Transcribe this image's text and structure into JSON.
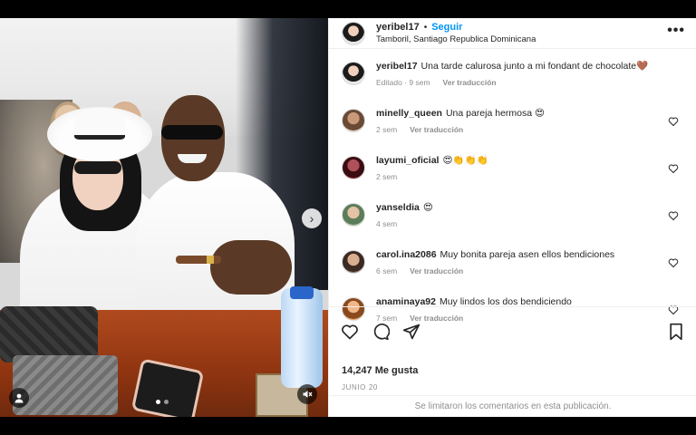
{
  "post": {
    "username": "yeribel17",
    "separator": "•",
    "follow_label": "Seguir",
    "location": "Tamboril, Santiago Republica Dominicana",
    "more_label": "•••",
    "caption": {
      "username": "yeribel17",
      "text": "Una tarde calurosa junto a mi fondant de chocolate🤎",
      "edited": "Editado · 9 sem",
      "translate": "Ver traducción"
    },
    "carousel": {
      "current": 1,
      "total": 2,
      "next_arrow": "›"
    }
  },
  "comments": [
    {
      "username": "minelly_queen",
      "text": "Una pareja hermosa 😍",
      "time": "2 sem",
      "translate": "Ver traducción"
    },
    {
      "username": "layumi_oficial",
      "text": "😍👏👏👏",
      "time": "2 sem",
      "translate": ""
    },
    {
      "username": "yanseldia",
      "text": "😍",
      "time": "4 sem",
      "translate": ""
    },
    {
      "username": "carol.ina2086",
      "text": "Muy bonita pareja asen ellos bendiciones",
      "time": "6 sem",
      "translate": "Ver traducción"
    },
    {
      "username": "anaminaya92",
      "text": "Muy lindos los dos bendiciendo",
      "time": "7 sem",
      "translate": "Ver traducción"
    }
  ],
  "engagement": {
    "likes": "14,247 Me gusta",
    "date": "JUNIO 20",
    "comments_limited": "Se limitaron los comentarios en esta publicación."
  },
  "colors": {
    "follow": "#0095f6",
    "muted_text": "#8e8e8e",
    "text": "#262626"
  }
}
